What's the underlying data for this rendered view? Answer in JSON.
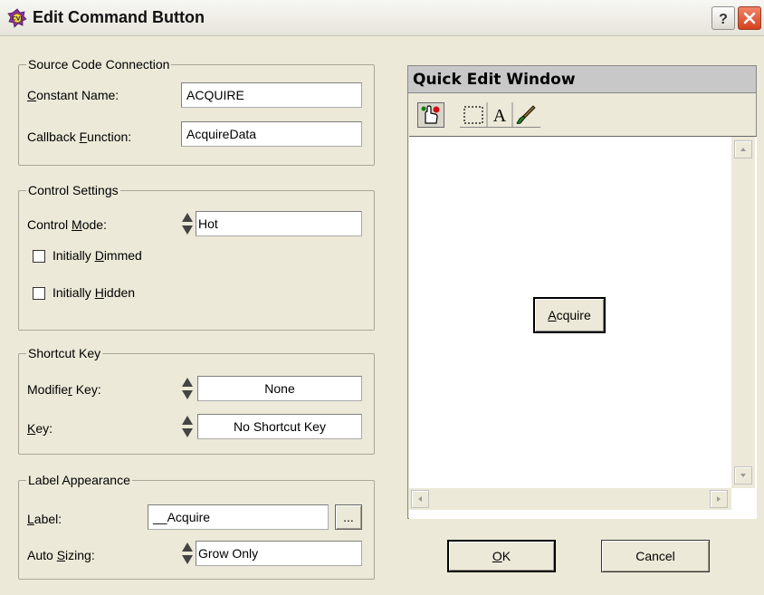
{
  "window": {
    "title": "Edit Command Button",
    "help_icon": "help-icon",
    "close_icon": "close-icon"
  },
  "source": {
    "legend": "Source Code Connection",
    "constant_label": "Constant Name:",
    "constant_value": "ACQUIRE",
    "callback_label": "Callback Function:",
    "callback_value": "AcquireData"
  },
  "control": {
    "legend": "Control Settings",
    "mode_label": "Control Mode:",
    "mode_value": "Hot",
    "dimmed_label": "Initially Dimmed",
    "dimmed_checked": false,
    "hidden_label": "Initially Hidden",
    "hidden_checked": false
  },
  "shortcut": {
    "legend": "Shortcut Key",
    "modifier_label": "Modifier Key:",
    "modifier_value": "None",
    "key_label": "Key:",
    "key_value": "No Shortcut Key"
  },
  "label_appearance": {
    "legend": "Label Appearance",
    "label_label": "Label:",
    "label_value": "__Acquire",
    "browse_label": "...",
    "autosize_label": "Auto Sizing:",
    "autosize_value": "Grow Only"
  },
  "quick_edit": {
    "title": "Quick Edit Window",
    "tools": [
      "operate-tool-icon",
      "selection-tool-icon",
      "text-tool-icon",
      "color-tool-icon"
    ],
    "preview_label": "Acquire"
  },
  "buttons": {
    "ok": "OK",
    "cancel": "Cancel"
  }
}
